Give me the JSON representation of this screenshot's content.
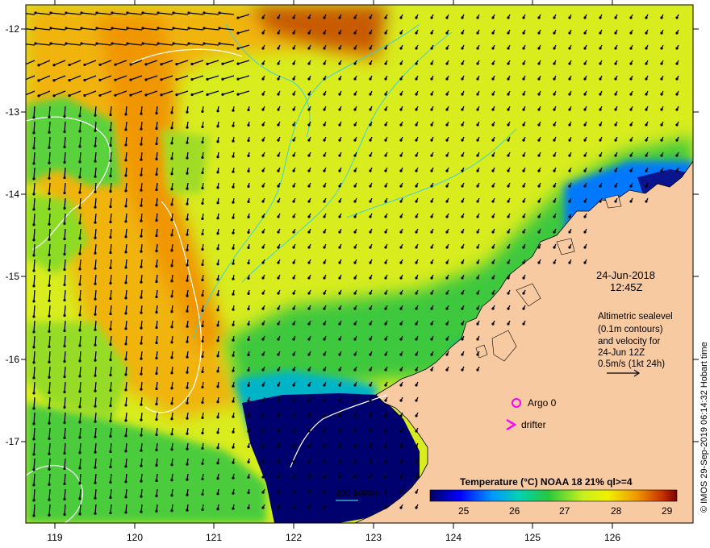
{
  "map": {
    "lon_ticks": [
      "119",
      "120",
      "121",
      "122",
      "123",
      "124",
      "125",
      "126"
    ],
    "lat_ticks": [
      "-12",
      "-13",
      "-14",
      "-15",
      "-16",
      "-17"
    ],
    "date": "24-Jun-2018",
    "time": "12:45Z",
    "legend_lines": [
      "Altimetric sealevel",
      "(0.1m contours)",
      "and velocity for",
      "24-Jun 12Z",
      "0.5m/s (1kt 24h)"
    ],
    "argo_label": "Argo 0",
    "drifter_label": "drifter",
    "colorbar_title": "Temperature (°C) NOAA 18 21% ql>=4",
    "colorbar_ticks": [
      "25",
      "26",
      "27",
      "28",
      "29"
    ],
    "depth_label": "200  1000m",
    "credit": "© IMOS 29-Sep-2019 06:14:32 Hobart time"
  },
  "colors": {
    "land": "#f8caa2",
    "cold": "#00006e",
    "blue": "#0050ff",
    "cyan": "#00c8c8",
    "green": "#28c83c",
    "yellow": "#e6f01e",
    "orange": "#f09600",
    "red": "#b41400",
    "contour_cyan": "#3cd2dc",
    "argo_magenta": "#ff00ff"
  }
}
